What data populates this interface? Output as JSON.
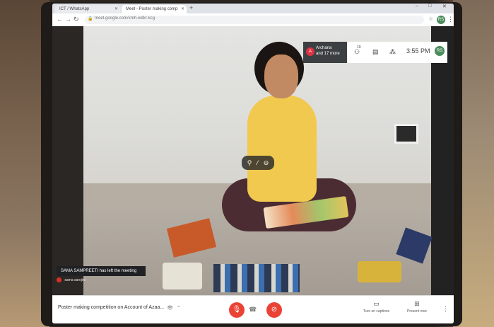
{
  "browser": {
    "tabs": [
      {
        "label": "ICT / WhatsApp",
        "active": false
      },
      {
        "label": "Meet - Poster making comp",
        "active": true
      }
    ],
    "new_tab_icon": "plus-icon",
    "url": "meet.google.com/xmh-wdkr-kcg",
    "profile_initial": "RS"
  },
  "meet": {
    "participants_tile": {
      "name": "Archana",
      "more": "and 17 more"
    },
    "top_icons": [
      "people-icon",
      "chat-icon",
      "activities-icon"
    ],
    "participant_count": "19",
    "time": "3:55 PM",
    "me_initial": "RS",
    "toast": "SAMA SAMPREETI has left the meeting",
    "self_label": "sama sarojini",
    "pill_icons": [
      "pin-icon",
      "mute-icon",
      "remove-icon"
    ]
  },
  "bottom_bar": {
    "meeting_title": "Poster making competition on Account of Azaa...",
    "controls": [
      {
        "name": "mic-off-button",
        "icon": "mic-off-icon"
      },
      {
        "name": "hangup-button",
        "icon": "phone-icon"
      },
      {
        "name": "camera-off-button",
        "icon": "camera-off-icon"
      }
    ],
    "captions_label": "Turn on captions",
    "present_label": "Present now"
  },
  "colors": {
    "meet_red": "#ea4335",
    "shirt_yellow": "#f1c94f",
    "dark_ui": "#202124"
  }
}
